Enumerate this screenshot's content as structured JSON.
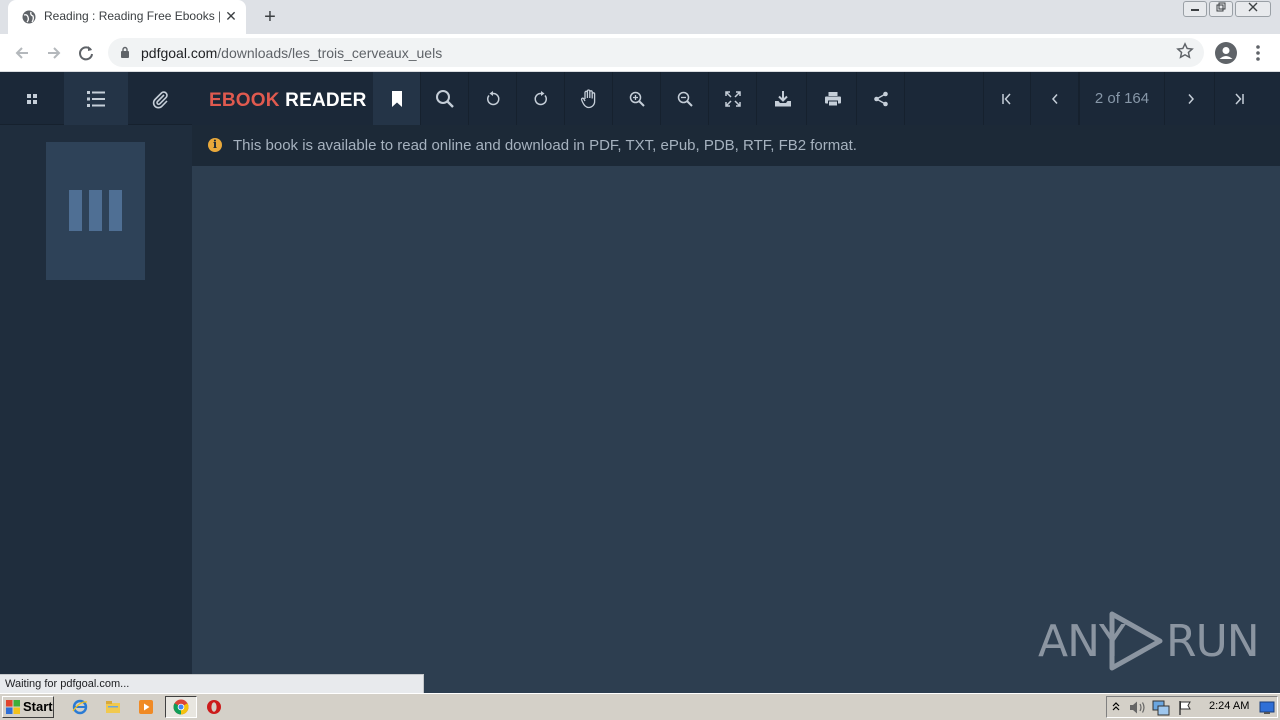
{
  "browser": {
    "tab_title": "Reading : Reading Free Ebooks | PDF",
    "tab_close": "✕",
    "new_tab": "+",
    "url_host": "pdfgoal.com",
    "url_path": "/downloads/les_trois_cerveaux_uels",
    "status_text": "Waiting for pdfgoal.com..."
  },
  "reader": {
    "brand_part1": "EBOOK",
    "brand_part2": "READER",
    "page_indicator": "2 of 164",
    "info_message": "This book is available to read online and download in PDF, TXT, ePub, PDB, RTF, FB2 format.",
    "info_icon_glyph": "i",
    "sidebar_tools": [
      "thumbnails-icon",
      "outline-icon",
      "attachment-icon"
    ],
    "toolbar_tools": [
      "bookmark-icon",
      "search-icon",
      "rotate-left-icon",
      "rotate-right-icon",
      "hand-tool-icon",
      "zoom-in-icon",
      "zoom-out-icon",
      "fullscreen-icon",
      "download-icon",
      "print-icon",
      "share-icon"
    ],
    "nav_tools": [
      "first-page-icon",
      "prev-page-icon",
      "next-page-icon",
      "last-page-icon"
    ]
  },
  "watermark": {
    "text_left": "ANY",
    "text_right": "RUN"
  },
  "taskbar": {
    "start_label": "Start",
    "clock": "2:24 AM"
  },
  "colors": {
    "brand_accent": "#e05a4f",
    "info_icon": "#e9a93b",
    "viewer_bg": "#2d3e50",
    "toolbar_bg": "#1b2838"
  }
}
